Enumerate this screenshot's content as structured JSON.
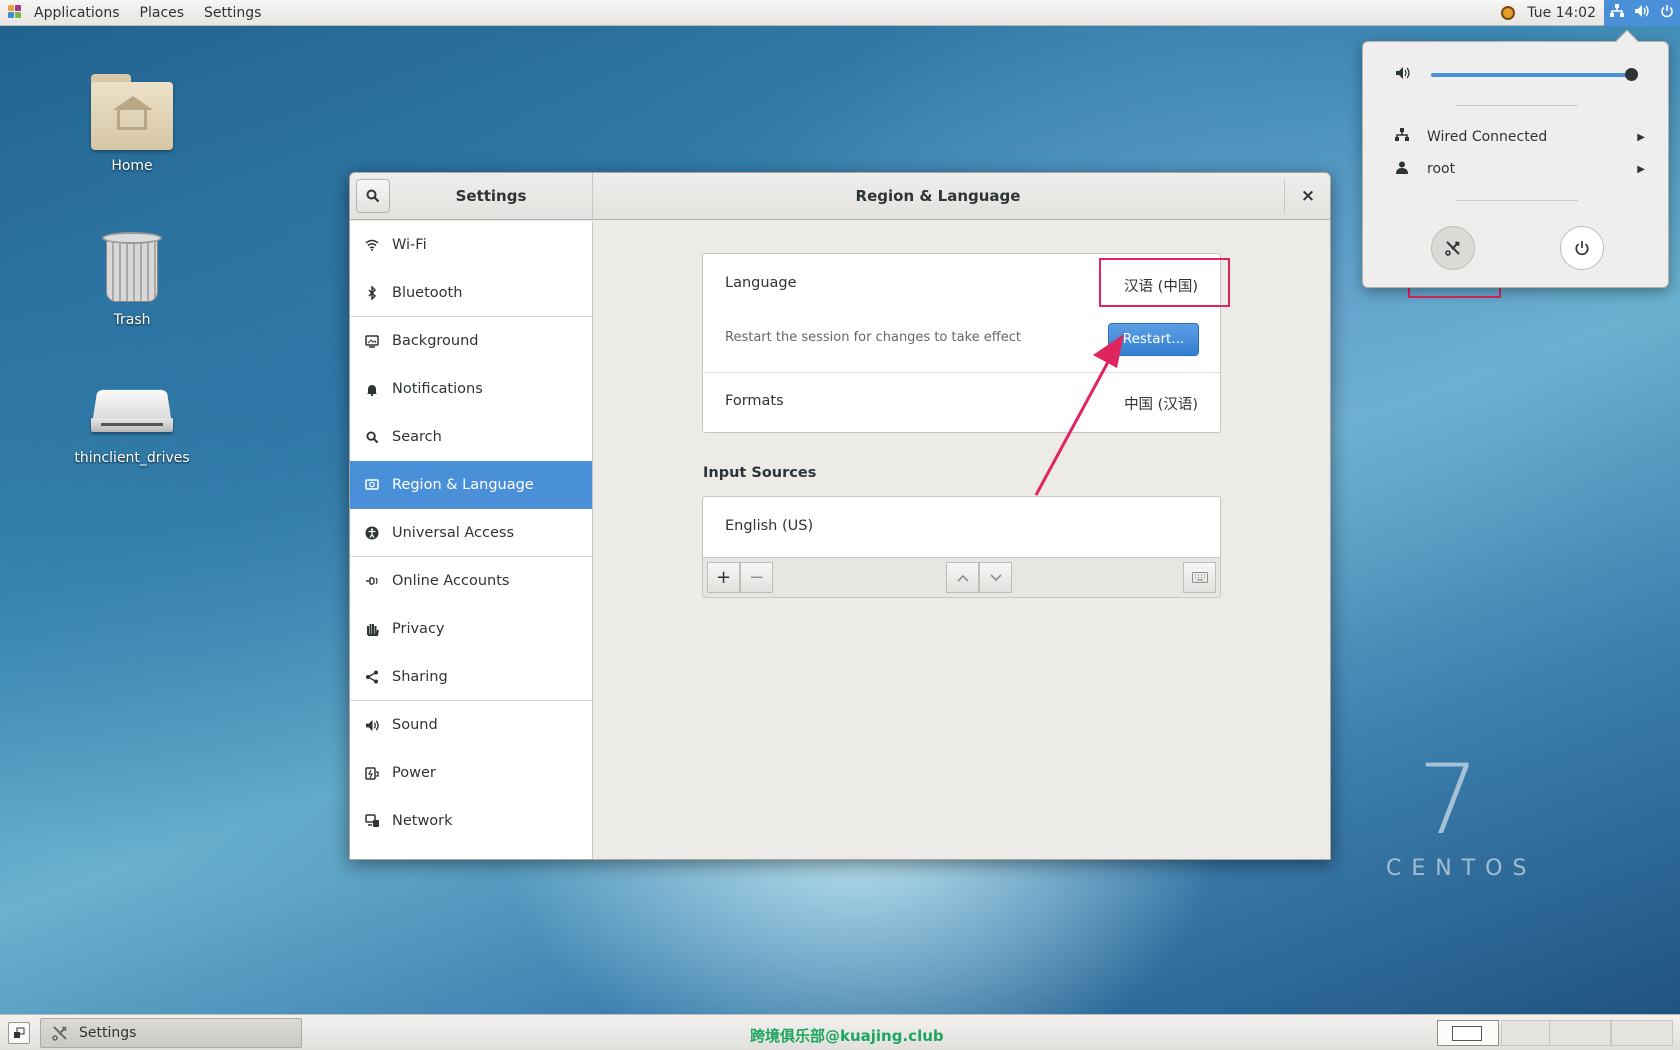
{
  "topbar": {
    "menus": [
      "Applications",
      "Places",
      "Settings"
    ],
    "clock": "Tue 14:02",
    "tray_icons": [
      "network-icon",
      "volume-icon",
      "power-icon"
    ]
  },
  "desktop": {
    "icons": [
      {
        "label": "Home",
        "icon": "home-folder-icon"
      },
      {
        "label": "Trash",
        "icon": "trash-icon"
      },
      {
        "label": "thinclient_drives",
        "icon": "drive-icon"
      }
    ],
    "brand_number": "7",
    "brand_word": "CENTOS"
  },
  "window": {
    "sidebar_title": "Settings",
    "panel_title": "Region & Language",
    "close_label": "×",
    "sidebar_items": [
      {
        "label": "Wi-Fi",
        "icon": "wifi-icon"
      },
      {
        "label": "Bluetooth",
        "icon": "bluetooth-icon"
      },
      {
        "label": "Background",
        "icon": "background-icon"
      },
      {
        "label": "Notifications",
        "icon": "bell-icon"
      },
      {
        "label": "Search",
        "icon": "search-icon"
      },
      {
        "label": "Region & Language",
        "icon": "region-icon",
        "active": true
      },
      {
        "label": "Universal Access",
        "icon": "accessibility-icon"
      },
      {
        "label": "Online Accounts",
        "icon": "online-accounts-icon"
      },
      {
        "label": "Privacy",
        "icon": "hand-icon"
      },
      {
        "label": "Sharing",
        "icon": "share-icon"
      },
      {
        "label": "Sound",
        "icon": "speaker-icon"
      },
      {
        "label": "Power",
        "icon": "battery-icon"
      },
      {
        "label": "Network",
        "icon": "network-icon"
      }
    ],
    "language": {
      "label": "Language",
      "value": "汉语 (中国)"
    },
    "restart": {
      "note": "Restart the session for changes to take effect",
      "button": "Restart..."
    },
    "formats": {
      "label": "Formats",
      "value": "中国 (汉语)"
    },
    "input_sources": {
      "title": "Input Sources",
      "items": [
        "English (US)"
      ],
      "toolbar": {
        "add": "+",
        "remove": "−",
        "up": "⌃",
        "down": "⌄"
      }
    }
  },
  "popover": {
    "volume_fraction": 0.97,
    "wired": "Wired Connected",
    "user": "root",
    "buttons": [
      "settings-icon",
      "power-icon"
    ]
  },
  "bottombar": {
    "task_label": "Settings",
    "watermark": "跨境俱乐部@kuajing.club",
    "workspaces": 4,
    "active_workspace": 1
  },
  "colors": {
    "accent": "#4a90d9",
    "annotation": "#e0245e",
    "watermark": "#1da65f"
  }
}
